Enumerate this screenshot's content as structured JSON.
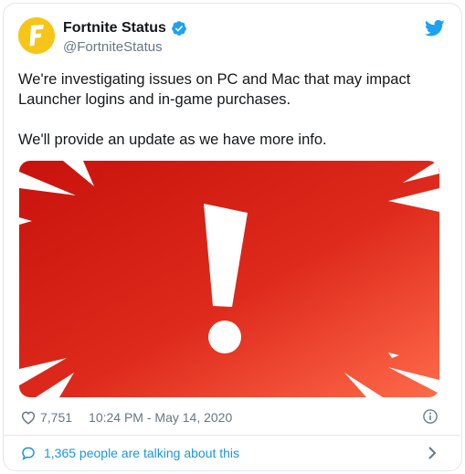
{
  "tweet": {
    "author": {
      "display_name": "Fortnite Status",
      "handle": "@FortniteStatus",
      "avatar_letter": "F",
      "verified": true
    },
    "text_paragraphs": [
      "We're investigating issues on PC and Mac that may impact Launcher logins and in-game purchases.",
      "We'll provide an update as we have more info."
    ],
    "media": {
      "icon": "exclamation-mark",
      "background_color": "#d91c14",
      "accent_color": "#ff6644"
    },
    "likes": "7,751",
    "timestamp": "10:24 PM - May 14, 2020",
    "conversation_text": "1,365 people are talking about this"
  },
  "colors": {
    "link_blue": "#1b95e0",
    "muted_gray": "#657786",
    "avatar_yellow": "#f5c518"
  }
}
